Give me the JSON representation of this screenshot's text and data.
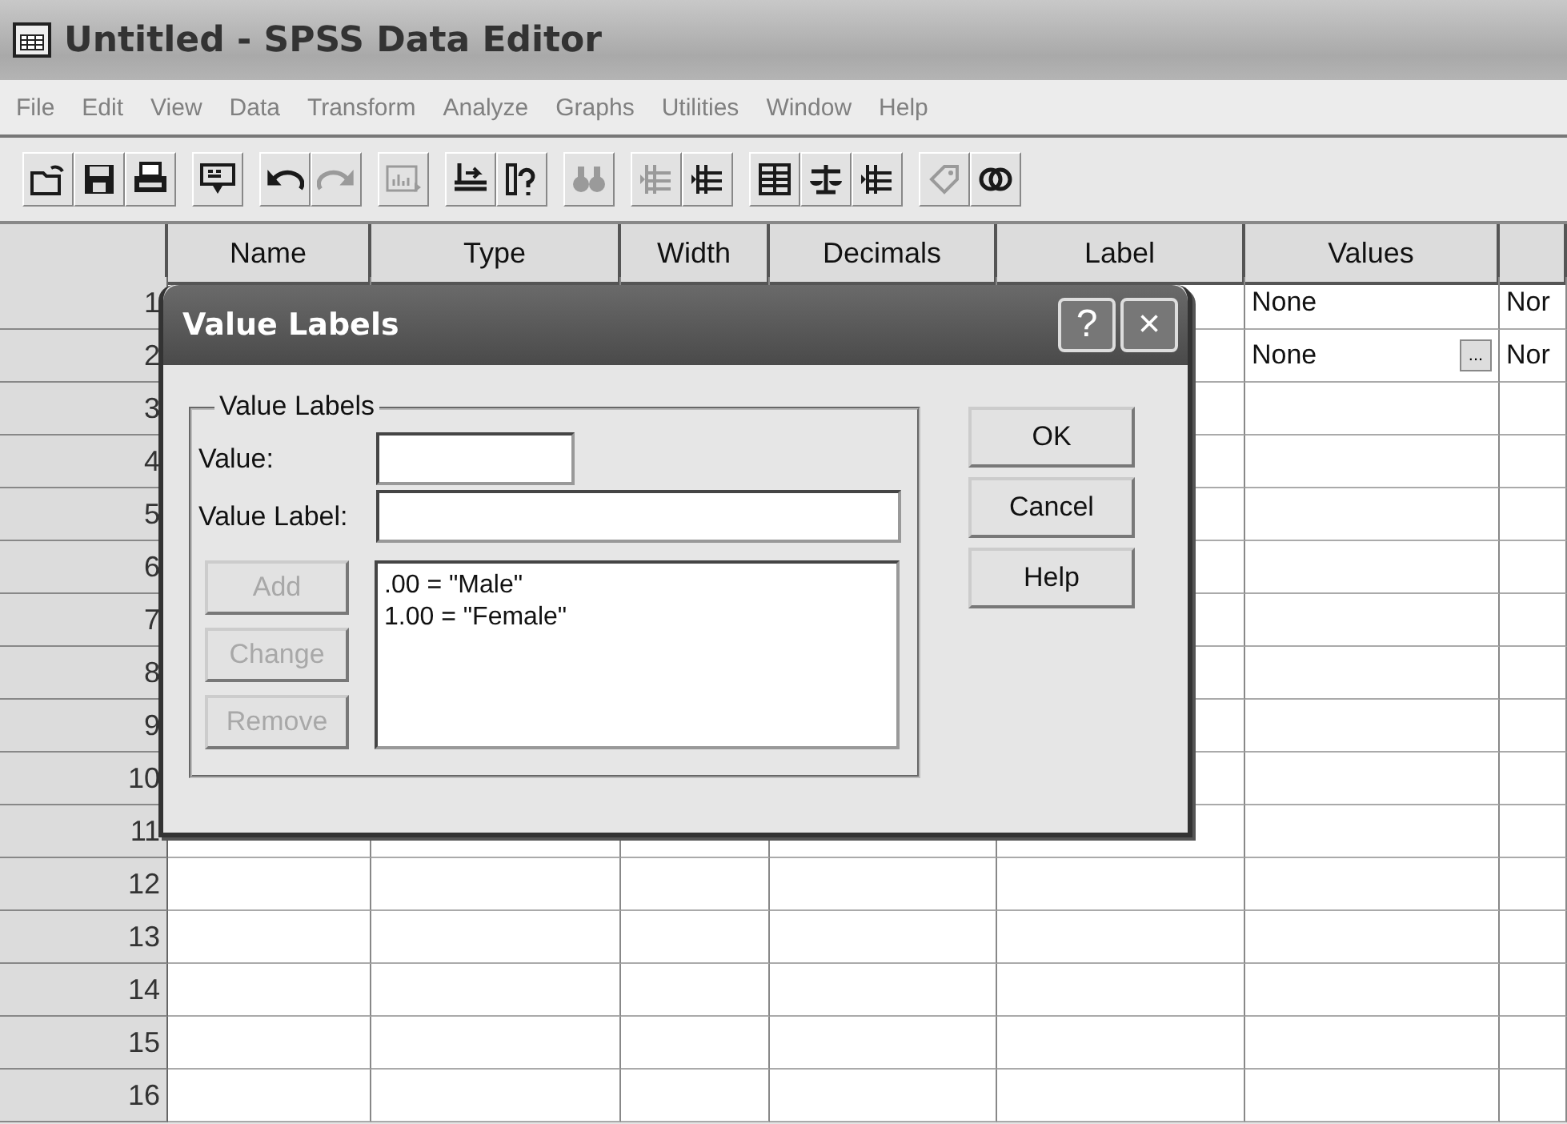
{
  "window": {
    "title": "Untitled - SPSS Data Editor"
  },
  "menu": [
    "File",
    "Edit",
    "View",
    "Data",
    "Transform",
    "Analyze",
    "Graphs",
    "Utilities",
    "Window",
    "Help"
  ],
  "toolbar": [
    {
      "disabled": false
    },
    {
      "disabled": false
    },
    {
      "disabled": false
    },
    {
      "disabled": false
    },
    {
      "disabled": false
    },
    {
      "disabled": true
    },
    {
      "disabled": true
    },
    {
      "disabled": false
    },
    {
      "disabled": false
    },
    {
      "disabled": true
    },
    {
      "disabled": true
    },
    {
      "disabled": false
    },
    {
      "disabled": false
    },
    {
      "disabled": false
    },
    {
      "disabled": false
    },
    {
      "disabled": true
    },
    {
      "disabled": false
    }
  ],
  "table": {
    "columns": [
      "Name",
      "Type",
      "Width",
      "Decimals",
      "Label",
      "Values",
      ""
    ],
    "rows": [
      {
        "number": "1",
        "values": "None",
        "column_7": "Nor"
      },
      {
        "number": "2",
        "values": "None",
        "values_button": "...",
        "column_7": "Nor"
      },
      {
        "number": "3"
      },
      {
        "number": "4"
      },
      {
        "number": "5"
      },
      {
        "number": "6"
      },
      {
        "number": "7"
      },
      {
        "number": "8"
      },
      {
        "number": "9"
      },
      {
        "number": "10"
      },
      {
        "number": "11"
      },
      {
        "number": "12"
      },
      {
        "number": "13"
      },
      {
        "number": "14"
      },
      {
        "number": "15"
      },
      {
        "number": "16"
      }
    ]
  },
  "dialog": {
    "title": "Value Labels",
    "help_button": "?",
    "close_button": "×",
    "group_title": "Value Labels",
    "value_label": "Value:",
    "value_label_label": "Value Label:",
    "side_buttons": [
      {
        "label": "Add",
        "disabled": true
      },
      {
        "label": "Change",
        "disabled": true
      },
      {
        "label": "Remove",
        "disabled": true
      }
    ],
    "list_items": [
      ".00 = \"Male\"",
      "1.00 = \"Female\""
    ],
    "buttons": [
      "OK",
      "Cancel",
      "Help"
    ]
  }
}
